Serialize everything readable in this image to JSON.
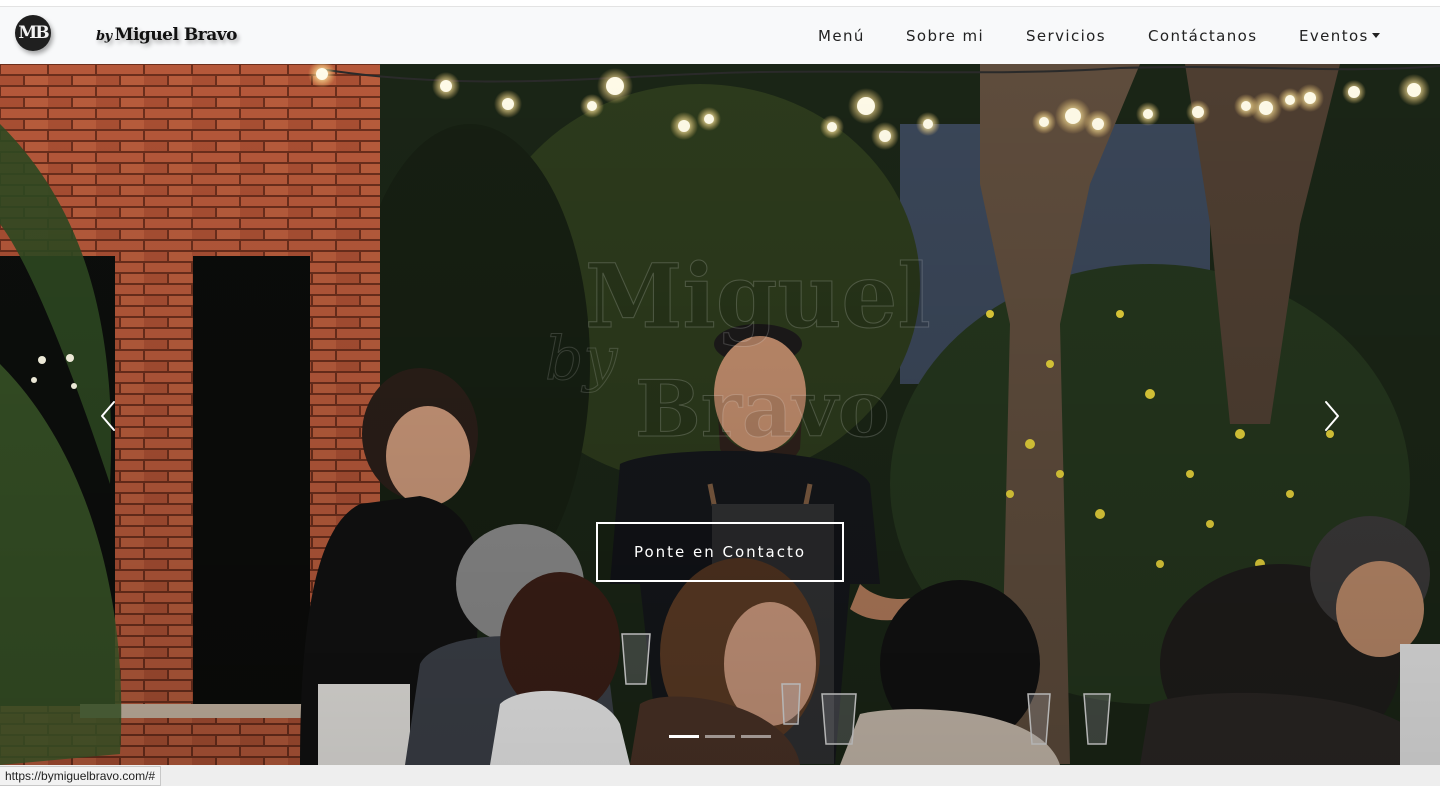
{
  "brand": {
    "monogram": "MB",
    "by": "by",
    "name": "Miguel Bravo"
  },
  "nav": {
    "items": [
      {
        "label": "Menú"
      },
      {
        "label": "Sobre mi"
      },
      {
        "label": "Servicios"
      },
      {
        "label": "Contáctanos"
      },
      {
        "label": "Eventos",
        "dropdown": true
      }
    ]
  },
  "hero": {
    "watermark_line1": "Miguel",
    "watermark_by": "by",
    "watermark_line2": "Bravo",
    "cta_label": "Ponte en Contacto",
    "prev_icon": "chevron-left-icon",
    "next_icon": "chevron-right-icon",
    "slides_total": 3,
    "active_slide": 1
  },
  "status": {
    "url": "https://bymiguelbravo.com/#"
  },
  "colors": {
    "navbar_bg": "#f8f9fa",
    "nav_text": "#222222",
    "cta_border": "#ffffff"
  }
}
